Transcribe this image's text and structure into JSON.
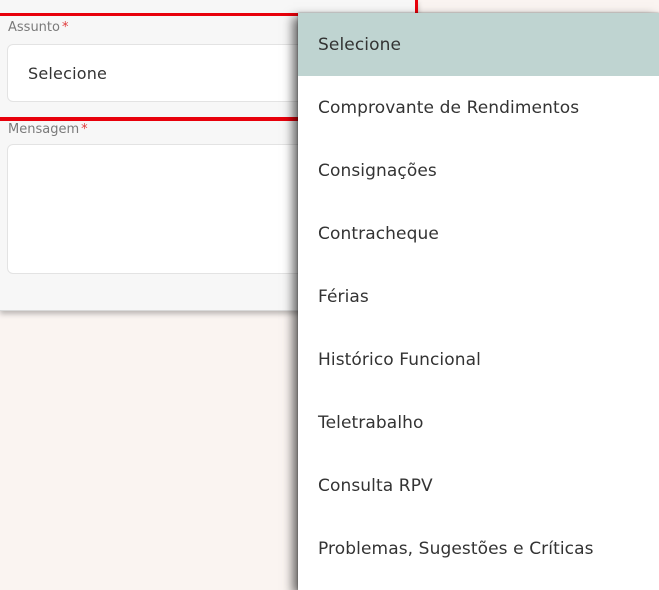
{
  "form": {
    "subject_label": "Assunto",
    "required_mark": "*",
    "subject_value": "Selecione",
    "message_label": "Mensagem",
    "message_value": ""
  },
  "dropdown": {
    "options": [
      "Selecione",
      "Comprovante de Rendimentos",
      "Consignações",
      "Contracheque",
      "Férias",
      "Histórico Funcional",
      "Teletrabalho",
      "Consulta RPV",
      "Problemas, Sugestões e Críticas"
    ],
    "selected_index": 0,
    "colors": {
      "selected_bg": "#bfd4d1",
      "highlight": "#e8000b"
    }
  }
}
